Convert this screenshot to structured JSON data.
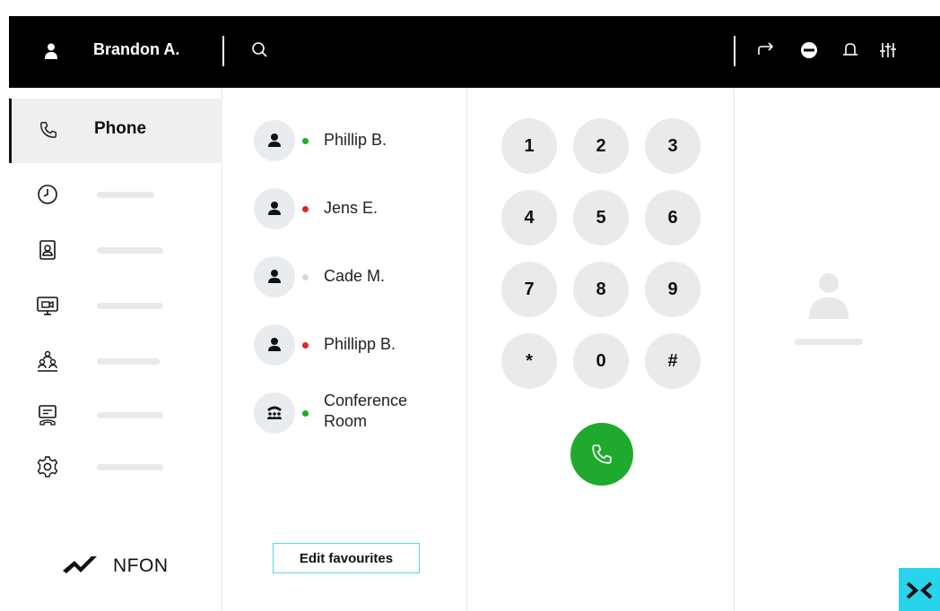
{
  "header": {
    "user_name": "Brandon A.",
    "icons": [
      "user-icon",
      "search-icon",
      "call-forward-icon",
      "do-not-disturb-icon",
      "bell-icon",
      "settings-sliders-icon"
    ]
  },
  "sidebar": {
    "active_item": {
      "label": "Phone",
      "icon": "phone-icon"
    },
    "items": [
      {
        "icon": "history-clock-icon"
      },
      {
        "icon": "contacts-icon"
      },
      {
        "icon": "video-meeting-icon"
      },
      {
        "icon": "group-icon"
      },
      {
        "icon": "voicemail-icon"
      },
      {
        "icon": "settings-gear-icon"
      }
    ],
    "brand": "NFON"
  },
  "favourites": {
    "items": [
      {
        "name": "Phillip B.",
        "status_color": "#1faa2e",
        "icon": "person-icon"
      },
      {
        "name": "Jens E.",
        "status_color": "#e02424",
        "icon": "person-icon"
      },
      {
        "name": "Cade M.",
        "status_color": "#d6dadd",
        "icon": "person-icon"
      },
      {
        "name": "Phillipp B.",
        "status_color": "#e02424",
        "icon": "person-icon"
      },
      {
        "name": "Conference Room",
        "status_color": "#1faa2e",
        "icon": "conference-icon"
      }
    ],
    "edit_label": "Edit favourites"
  },
  "dialpad": {
    "keys": [
      "1",
      "2",
      "3",
      "4",
      "5",
      "6",
      "7",
      "8",
      "9",
      "*",
      "0",
      "#"
    ],
    "call_color": "#1faa2e"
  },
  "colors": {
    "accent": "#28d4ec",
    "topbar": "#000000",
    "online": "#1faa2e",
    "busy": "#e02424",
    "offline": "#d6dadd"
  }
}
